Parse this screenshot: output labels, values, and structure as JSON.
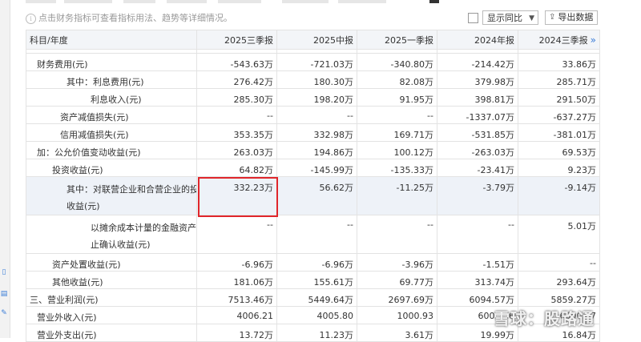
{
  "hint": "点击财务指标可查看指标用法、趋势等详细情况。",
  "compare_select": "显示同比",
  "export_label": "导出数据",
  "watermark": "雪球：股路通",
  "table": {
    "headers": [
      "科目/年度",
      "2025三季报",
      "2025中报",
      "2025一季报",
      "2024年报",
      "2024三季报"
    ],
    "scroll_glyph": "»",
    "rows": [
      {
        "label": "财务费用(元)",
        "values": [
          "-543.63万",
          "-721.03万",
          "-340.80万",
          "-214.42万",
          "33.86万"
        ]
      },
      {
        "label": "其中：利息费用(元)",
        "values": [
          "276.42万",
          "180.30万",
          "82.08万",
          "379.98万",
          "285.71万"
        ]
      },
      {
        "label": "利息收入(元)",
        "values": [
          "285.30万",
          "198.20万",
          "91.95万",
          "398.81万",
          "291.50万"
        ]
      },
      {
        "label": "资产减值损失(元)",
        "values": [
          "--",
          "--",
          "--",
          "-1337.07万",
          "-637.27万"
        ]
      },
      {
        "label": "信用减值损失(元)",
        "values": [
          "353.35万",
          "332.98万",
          "169.71万",
          "-531.85万",
          "-381.01万"
        ]
      },
      {
        "label": "加：公允价值变动收益(元)",
        "values": [
          "263.03万",
          "194.86万",
          "100.12万",
          "-263.03万",
          "69.53万"
        ]
      },
      {
        "label": "投资收益(元)",
        "values": [
          "64.82万",
          "-145.99万",
          "-135.33万",
          "-23.41万",
          "9.23万"
        ]
      },
      {
        "label_line1": "其中：对联营企业和合营企业的投资",
        "label_line2": "收益(元)",
        "values": [
          "332.23万",
          "56.62万",
          "-11.25万",
          "-3.79万",
          "-9.14万"
        ]
      },
      {
        "label_line1": "以摊余成本计量的金融资产终",
        "label_line2": "止确认收益(元)",
        "values": [
          "--",
          "--",
          "--",
          "--",
          "5.01万"
        ]
      },
      {
        "label": "资产处置收益(元)",
        "values": [
          "-6.96万",
          "-6.96万",
          "-3.96万",
          "-1.51万",
          "--"
        ]
      },
      {
        "label": "其他收益(元)",
        "values": [
          "181.06万",
          "155.61万",
          "69.77万",
          "313.74万",
          "293.64万"
        ]
      },
      {
        "label": "三、营业利润(元)",
        "values": [
          "7513.46万",
          "5449.64万",
          "2697.69万",
          "6094.57万",
          "5859.27万"
        ]
      },
      {
        "label": "营业外收入(元)",
        "values": [
          "4006.21",
          "4005.80",
          "1000.93",
          "6006.66",
          "6000.47"
        ]
      },
      {
        "label": "营业外支出(元)",
        "values": [
          "13.72万",
          "11.23万",
          "3.61万",
          "19.99万",
          "16.84万"
        ]
      }
    ]
  }
}
